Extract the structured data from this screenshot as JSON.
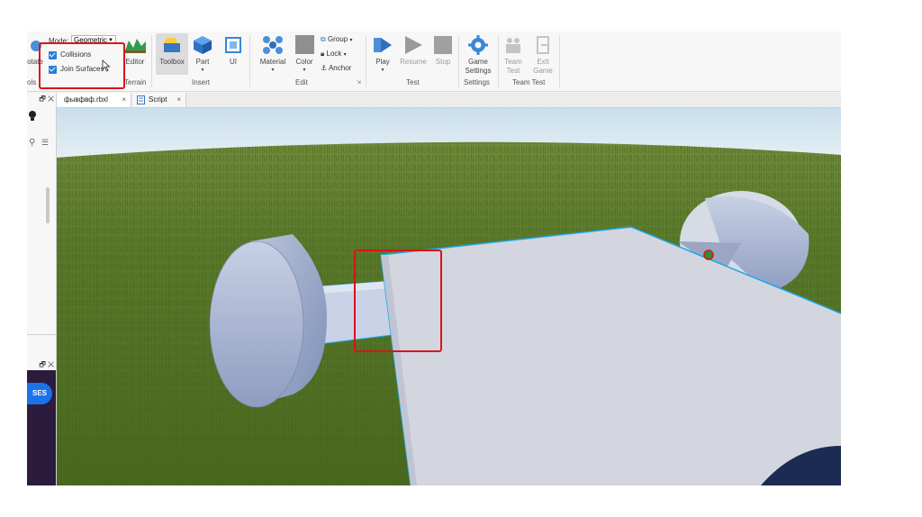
{
  "ribbon": {
    "mode_label": "Mode:",
    "mode_value": "Geometric",
    "collisions_label": "Collisions",
    "join_surfaces_label": "Join Surfaces",
    "rotate_label": "otate",
    "tools_group": "ols",
    "editor_label": "Editor",
    "terrain_group": "Terrain",
    "toolbox_label": "Toolbox",
    "part_label": "Part",
    "ui_label": "UI",
    "insert_group": "Insert",
    "material_label": "Material",
    "color_label": "Color",
    "group_label": "Group",
    "lock_label": "Lock",
    "anchor_label": "Anchor",
    "edit_group": "Edit",
    "play_label": "Play",
    "resume_label": "Resume",
    "stop_label": "Stop",
    "test_group": "Test",
    "game_settings_label_1": "Game",
    "game_settings_label_2": "Settings",
    "settings_group": "Settings",
    "team_test_label_1": "Team",
    "team_test_label_2": "Test",
    "exit_game_label_1": "Exit",
    "exit_game_label_2": "Game",
    "team_test_group": "Team Test"
  },
  "tabs": [
    {
      "label": "фывфвф.rbxl",
      "close": "×"
    },
    {
      "label": "Script",
      "close": "×"
    }
  ],
  "left_panel": {
    "top_controls": "🗗 ✕",
    "bottom_controls": "🗗 ✕",
    "ses_button": "SES"
  },
  "colors": {
    "highlight": "#d9141b",
    "selection": "#1ea7e6",
    "grass": "#5b7d2c",
    "sky": "#d6e7f0"
  }
}
